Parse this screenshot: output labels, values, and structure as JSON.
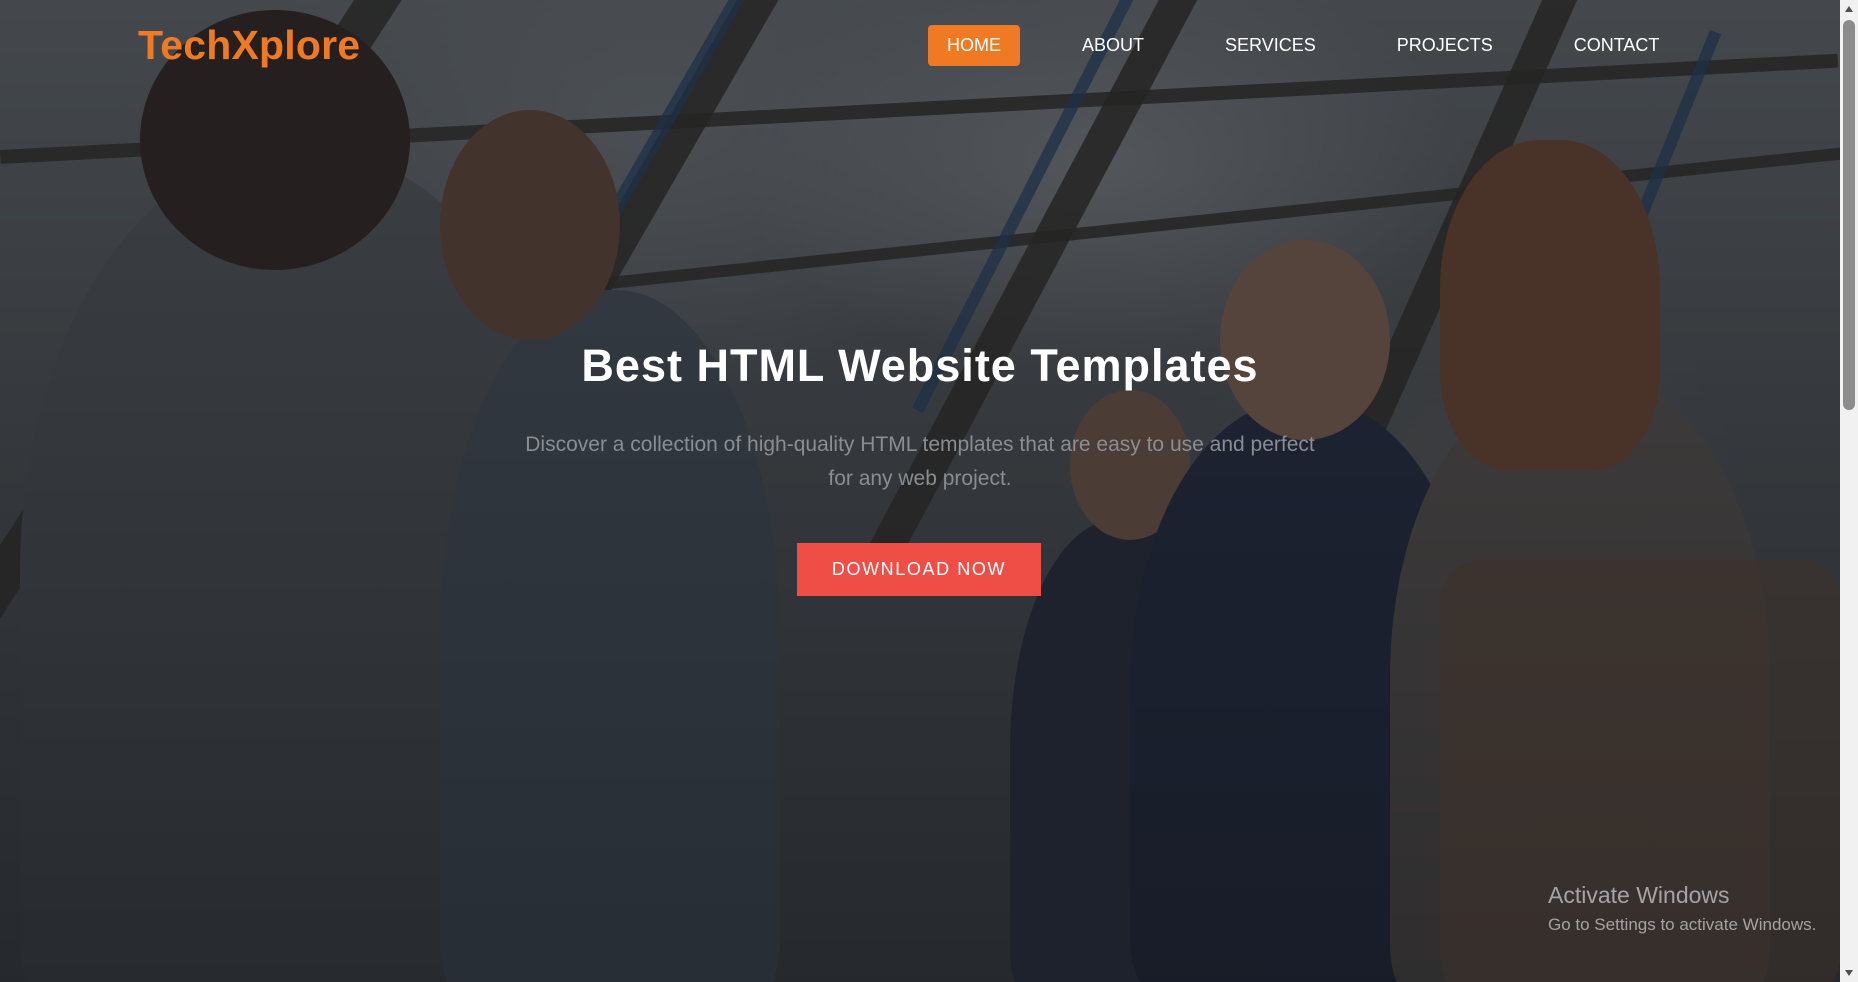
{
  "brand": {
    "name": "TechXplore",
    "color": "#f07a23"
  },
  "nav": {
    "items": [
      {
        "label": "HOME",
        "active": true
      },
      {
        "label": "ABOUT",
        "active": false
      },
      {
        "label": "SERVICES",
        "active": false
      },
      {
        "label": "PROJECTS",
        "active": false
      },
      {
        "label": "CONTACT",
        "active": false
      }
    ],
    "active_color": "#f07a23"
  },
  "hero": {
    "title": "Best HTML Website Templates",
    "subtitle": "Discover a collection of high-quality HTML templates that are easy to use and perfect for any web project.",
    "cta_label": "DOWNLOAD NOW",
    "cta_color": "#ef4e46",
    "background": "business people shaking hands and applauding in a bright office"
  },
  "watermark": {
    "title": "Activate Windows",
    "subtitle": "Go to Settings to activate Windows."
  },
  "scrollbar": {
    "up_icon": "scroll-up-arrow-icon",
    "down_icon": "scroll-down-arrow-icon"
  }
}
